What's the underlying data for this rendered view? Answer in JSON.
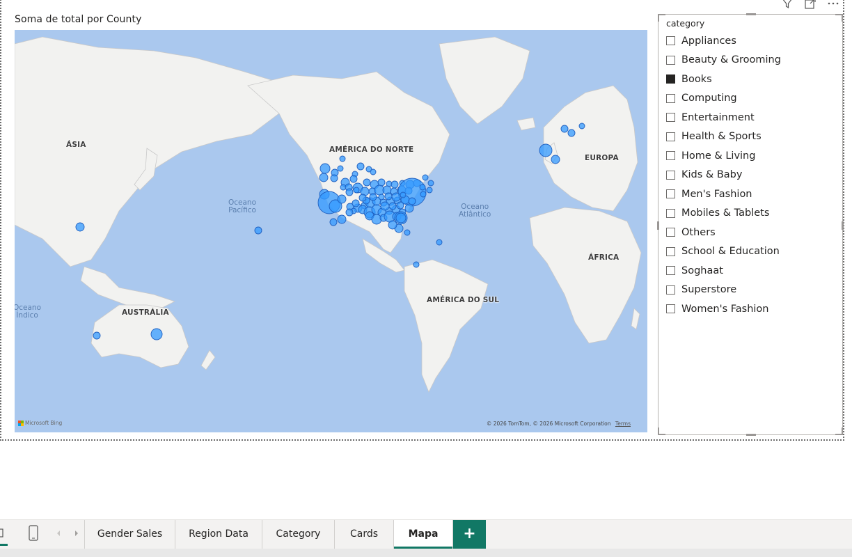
{
  "map_visual": {
    "title": "Soma de total por County",
    "continent_labels": {
      "asia": "ÁSIA",
      "north_america": "AMÉRICA DO NORTE",
      "europe": "EUROPA",
      "africa": "ÁFRICA",
      "south_america": "AMÉRICA DO SUL",
      "australia": "AUSTRÁLIA"
    },
    "ocean_labels": {
      "pacific": "Oceano\nPacífico",
      "atlantic": "Oceano\nAtlântico",
      "indian": "Oceano\nÍndico"
    },
    "attribution": {
      "logo_text": "Microsoft Bing",
      "copyright": "© 2026 TomTom, © 2026 Microsoft Corporation",
      "terms": "Terms"
    },
    "bubble_color": "#3399ff",
    "bubble_stroke": "#1f5fbf",
    "water_color": "#aac8ee",
    "land_color": "#f2f2f0"
  },
  "visual_header_icons": [
    "filter-icon",
    "focus-mode-icon",
    "more-options-icon"
  ],
  "slicer": {
    "title": "category",
    "items": [
      {
        "label": "Appliances",
        "checked": false
      },
      {
        "label": "Beauty & Grooming",
        "checked": false
      },
      {
        "label": "Books",
        "checked": true
      },
      {
        "label": "Computing",
        "checked": false
      },
      {
        "label": "Entertainment",
        "checked": false
      },
      {
        "label": "Health & Sports",
        "checked": false
      },
      {
        "label": "Home & Living",
        "checked": false
      },
      {
        "label": "Kids & Baby",
        "checked": false
      },
      {
        "label": "Men's Fashion",
        "checked": false
      },
      {
        "label": "Mobiles & Tablets",
        "checked": false
      },
      {
        "label": "Others",
        "checked": false
      },
      {
        "label": "School & Education",
        "checked": false
      },
      {
        "label": "Soghaat",
        "checked": false
      },
      {
        "label": "Superstore",
        "checked": false
      },
      {
        "label": "Women's Fashion",
        "checked": false
      }
    ]
  },
  "page_tabs": {
    "tabs": [
      "Gender Sales",
      "Region Data",
      "Category",
      "Cards",
      "Mapa"
    ],
    "active": "Mapa",
    "add_label": "+"
  },
  "accent_color": "#117865"
}
